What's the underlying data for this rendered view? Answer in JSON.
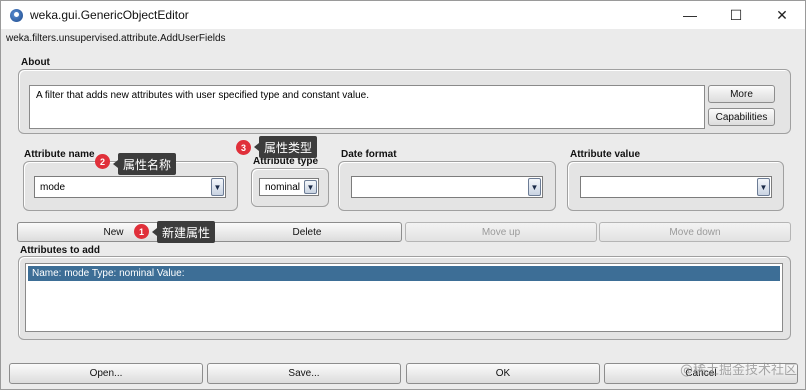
{
  "window": {
    "title": "weka.gui.GenericObjectEditor",
    "minimize_glyph": "—",
    "maximize_glyph": "☐",
    "close_glyph": "✕"
  },
  "class_name": "weka.filters.unsupervised.attribute.AddUserFields",
  "about": {
    "label": "About",
    "text": "A filter that adds new attributes with user specified type and constant value.",
    "more_button": "More",
    "capabilities_button": "Capabilities"
  },
  "fields": {
    "attribute_name": {
      "label": "Attribute name",
      "value": "mode"
    },
    "attribute_type": {
      "label": "Attribute type",
      "value": "nominal"
    },
    "date_format": {
      "label": "Date format",
      "value": ""
    },
    "attribute_value": {
      "label": "Attribute value",
      "value": ""
    }
  },
  "row_buttons": {
    "new": "New",
    "delete": "Delete",
    "move_up": "Move up",
    "move_down": "Move down"
  },
  "attributes_to_add": {
    "label": "Attributes to add",
    "items": [
      "Name: mode Type: nominal Value:"
    ]
  },
  "bottom_buttons": {
    "open": "Open...",
    "save": "Save...",
    "ok": "OK",
    "cancel": "Cancel"
  },
  "annotations": {
    "new_attr": {
      "number": "1",
      "text": "新建属性"
    },
    "attr_name": {
      "number": "2",
      "text": "属性名称"
    },
    "attr_type": {
      "number": "3",
      "text": "属性类型"
    }
  },
  "watermark": "@稀土掘金技术社区",
  "colors": {
    "selection": "#3d6e96",
    "badge": "#e0303a",
    "callout": "#3c3c3c"
  }
}
